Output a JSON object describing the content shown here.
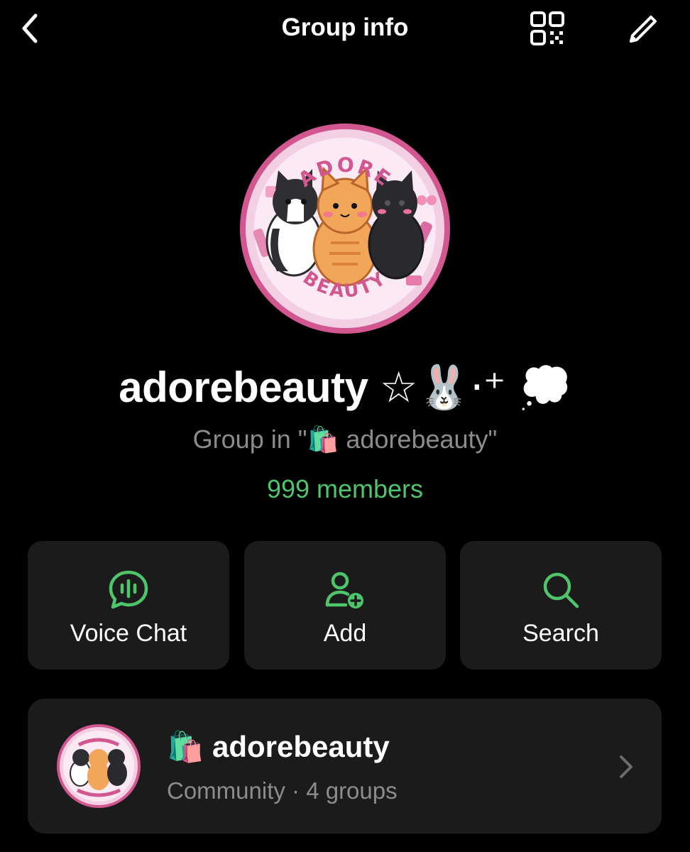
{
  "header": {
    "title": "Group info",
    "back_icon": "chevron-left-icon",
    "qr_icon": "qr-code-icon",
    "edit_icon": "pencil-icon"
  },
  "group": {
    "name": "adorebeauty",
    "name_decor": "☆🐰⋅⁺ 💭",
    "subtitle_prefix": "Group in \"",
    "subtitle_emoji": "🛍️",
    "subtitle_name": "adorebeauty\"",
    "members": "999 members",
    "avatar_logo_top": "ADORE",
    "avatar_logo_bottom": "BEAUTY"
  },
  "actions": [
    {
      "label": "Voice Chat",
      "icon": "voice-chat-icon"
    },
    {
      "label": "Add",
      "icon": "add-user-icon"
    },
    {
      "label": "Search",
      "icon": "search-icon"
    }
  ],
  "community": {
    "emoji": "🛍️",
    "name": "adorebeauty",
    "meta": "Community · 4 groups",
    "chevron_icon": "chevron-right-icon"
  },
  "colors": {
    "background": "#000000",
    "card": "#1b1b1b",
    "accent_green": "#4fc56b",
    "muted_text": "#8c8c8c",
    "logo_pink": "#e7a6cc",
    "logo_ring": "#d2568f"
  }
}
